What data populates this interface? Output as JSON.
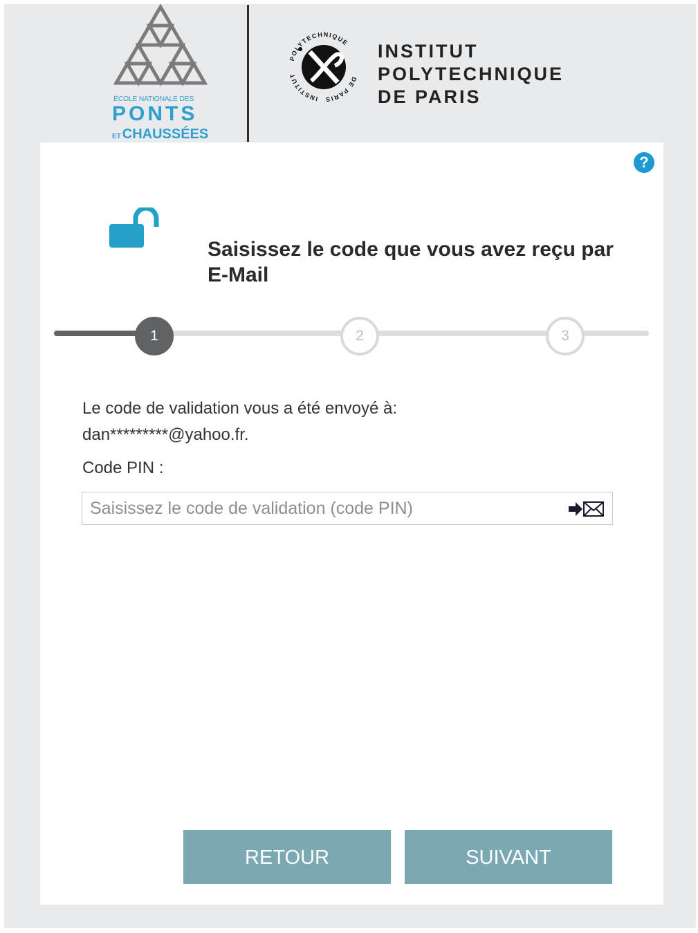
{
  "header": {
    "enpc_line1": "ÉCOLE NATIONALE DES",
    "enpc_line2": "PONTS",
    "enpc_line3_prefix": "ET",
    "enpc_line3": "CHAUSSÉES",
    "ipp_line1": "INSTITUT",
    "ipp_line2": "POLYTECHNIQUE",
    "ipp_line3": "DE PARIS",
    "ipp_seal_text_top": "POLYTECHNIQUE",
    "ipp_seal_text_left": "INSTITUT",
    "ipp_seal_text_bottom": "DE PARIS"
  },
  "card": {
    "help_symbol": "?",
    "title": "Saisissez le code que vous avez reçu par E-Mail",
    "steps": [
      "1",
      "2",
      "3"
    ],
    "active_step": 1,
    "sent_line1": "Le code de validation vous a été envoyé à:",
    "sent_line2": "dan*********@yahoo.fr.",
    "pin_label": "Code PIN :",
    "pin_placeholder": "Saisissez le code de validation (code PIN)",
    "pin_value": "",
    "back_label": "RETOUR",
    "next_label": "SUIVANT"
  },
  "colors": {
    "accent": "#1b9bd1",
    "button": "#7aa9b3",
    "step_active": "#606266",
    "brand_enpc": "#2f9fcf"
  },
  "icons": {
    "help": "question-circle-icon",
    "lock": "unlocked-padlock-icon",
    "mail": "arrow-envelope-icon"
  }
}
